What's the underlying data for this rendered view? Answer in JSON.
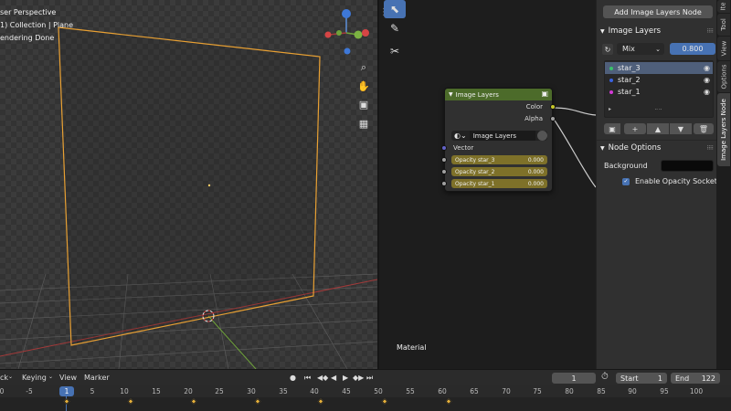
{
  "viewport": {
    "lines": [
      "ser Perspective",
      "1) Collection | Plane",
      "endering Done"
    ],
    "gizmo": {
      "z": "Z",
      "y": "Y"
    },
    "icons": [
      "zoom-icon",
      "hand-icon",
      "camera-icon",
      "grid-icon"
    ]
  },
  "node_editor": {
    "node": {
      "title": "Image Layers",
      "outputs": [
        "Color",
        "Alpha"
      ],
      "image_field": "Image Layers",
      "input_label": "Vector",
      "sliders": [
        {
          "label": "Opacity star_3",
          "value": "0.000"
        },
        {
          "label": "Opacity star_2",
          "value": "0.000"
        },
        {
          "label": "Opacity star_1",
          "value": "0.000"
        }
      ]
    },
    "material_label": "Material"
  },
  "sidebar": {
    "add_button": "Add Image Layers Node",
    "image_layers_header": "Image Layers",
    "blend_mode": "Mix",
    "blend_value": "0.800",
    "layers": [
      {
        "name": "star_3",
        "color": "#3ac26a"
      },
      {
        "name": "star_2",
        "color": "#3a62e0"
      },
      {
        "name": "star_1",
        "color": "#d43ad6"
      }
    ],
    "node_options_header": "Node Options",
    "background_label": "Background",
    "background_color": "#0a0a0a",
    "opacity_sockets_label": "Enable Opacity Sockets"
  },
  "tabs": [
    "Ite",
    "Tool",
    "View",
    "Options",
    "Image Layers Node"
  ],
  "timeline": {
    "menus": [
      "ck",
      "Keying",
      "View",
      "Marker"
    ],
    "current_frame": "1",
    "start_label": "Start",
    "start_value": "1",
    "end_label": "End",
    "end_value": "122",
    "ticks": [
      "0",
      "-5",
      "1",
      "5",
      "10",
      "15",
      "20",
      "25",
      "30",
      "35",
      "40",
      "45",
      "50",
      "55",
      "60",
      "65",
      "70",
      "75",
      "80",
      "85",
      "90",
      "95",
      "100"
    ]
  },
  "colors": {
    "accent": "#4772b3",
    "node_header": "#4c6b2a",
    "slider": "#7e7129",
    "plane_outline": "#e8a033",
    "keyframe": "#e8b13a"
  }
}
